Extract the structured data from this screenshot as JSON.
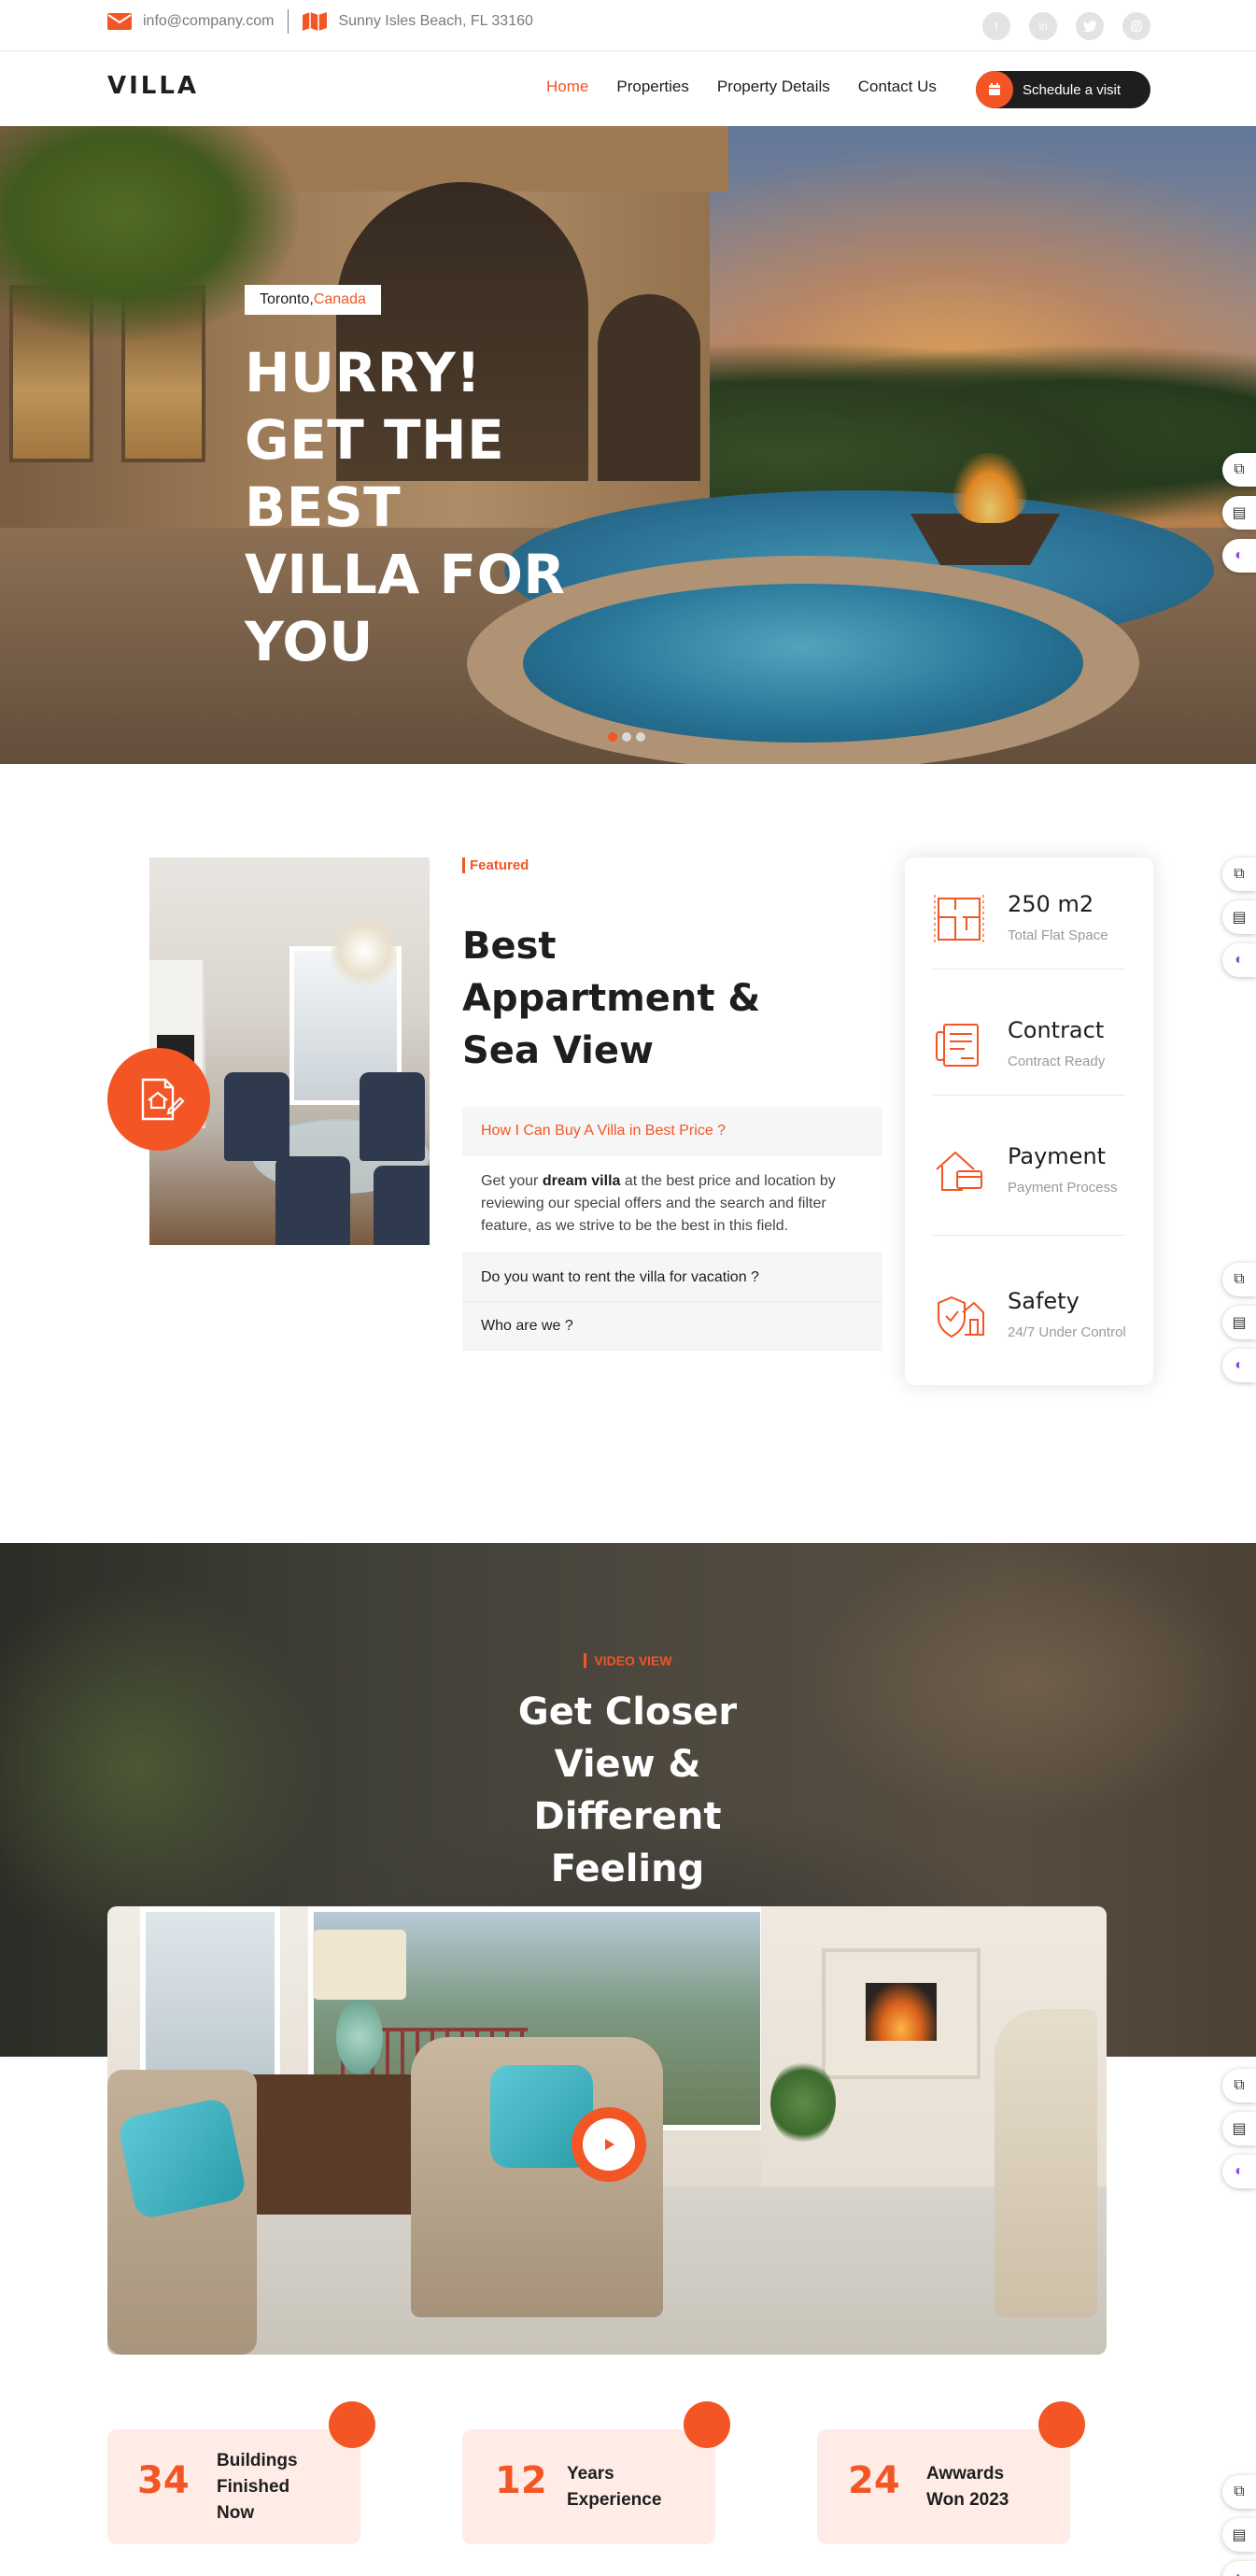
{
  "topbar": {
    "email": "info@company.com",
    "address": "Sunny Isles Beach, FL 33160",
    "socials": [
      "facebook-icon",
      "linkedin-icon",
      "twitter-icon",
      "instagram-icon"
    ]
  },
  "nav": {
    "logo": "VILLA",
    "items": [
      {
        "label": "Home",
        "active": true
      },
      {
        "label": "Properties",
        "active": false
      },
      {
        "label": "Property Details",
        "active": false
      },
      {
        "label": "Contact Us",
        "active": false
      }
    ],
    "cta": "Schedule a visit"
  },
  "hero": {
    "location_city": "Toronto,",
    "location_country": "Canada",
    "headline_lines": [
      "HURRY!",
      "GET THE BEST",
      "VILLA FOR",
      "YOU"
    ],
    "slides": 3,
    "active_slide": 1
  },
  "featured": {
    "tag": "Featured",
    "title_lines": [
      "Best",
      "Appartment &",
      "Sea View"
    ],
    "faq": [
      {
        "question": "How I Can Buy A Villa in Best Price ?",
        "open": true,
        "answer_before": "Get your ",
        "answer_bold": "dream villa",
        "answer_after": " at the best price and location by reviewing our special offers and the search and filter feature, as we strive to be the best in this field."
      },
      {
        "question": "Do you want to rent the villa for vacation ?",
        "open": false
      },
      {
        "question": "Who are we ?",
        "open": false
      }
    ]
  },
  "info": [
    {
      "title": "250 m2",
      "sub": "Total Flat Space",
      "icon": "floorplan-icon"
    },
    {
      "title": "Contract",
      "sub": "Contract Ready",
      "icon": "contract-icon"
    },
    {
      "title": "Payment",
      "sub": "Payment Process",
      "icon": "payment-house-icon"
    },
    {
      "title": "Safety",
      "sub": "24/7 Under Control",
      "icon": "safety-shield-icon"
    }
  ],
  "video": {
    "tag": "VIDEO VIEW",
    "title_lines": [
      "Get Closer",
      "View &",
      "Different",
      "Feeling"
    ]
  },
  "stats": [
    {
      "number": "34",
      "label": "Buildings Finished Now"
    },
    {
      "number": "12",
      "label": "Years Experience"
    },
    {
      "number": "24",
      "label": "Awwards Won 2023"
    }
  ],
  "colors": {
    "accent": "#f35525",
    "dark": "#1e1e1e",
    "stat_bg": "#ffece6"
  }
}
